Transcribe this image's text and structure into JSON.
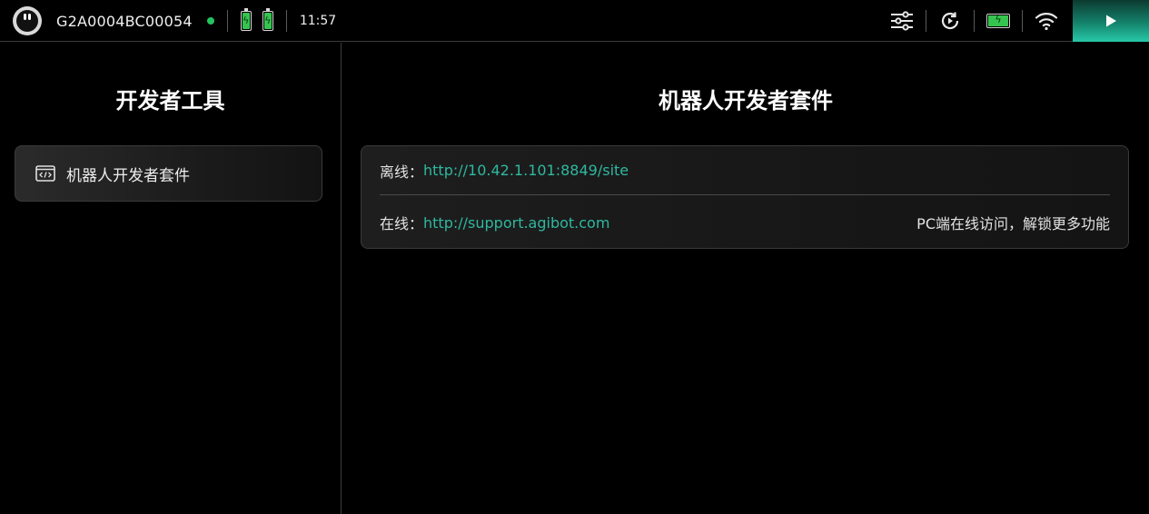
{
  "statusbar": {
    "device_id": "G2A0004BC00054",
    "time": "11:57",
    "online_color": "#22c55e",
    "accent_color": "#27c8a8",
    "icons": [
      "robot-avatar-icon",
      "battery-icon",
      "battery-icon",
      "sliders-icon",
      "refresh-play-icon",
      "battery-charging-icon",
      "wifi-icon",
      "play-icon"
    ]
  },
  "sidebar": {
    "title": "开发者工具",
    "items": [
      {
        "label": "机器人开发者套件",
        "icon": "code-window-icon"
      }
    ]
  },
  "main": {
    "title": "机器人开发者套件",
    "rows": [
      {
        "key": "离线：",
        "url": "http://10.42.1.101:8849/site",
        "note": ""
      },
      {
        "key": "在线：",
        "url": "http://support.agibot.com",
        "note": "PC端在线访问，解锁更多功能"
      }
    ]
  }
}
